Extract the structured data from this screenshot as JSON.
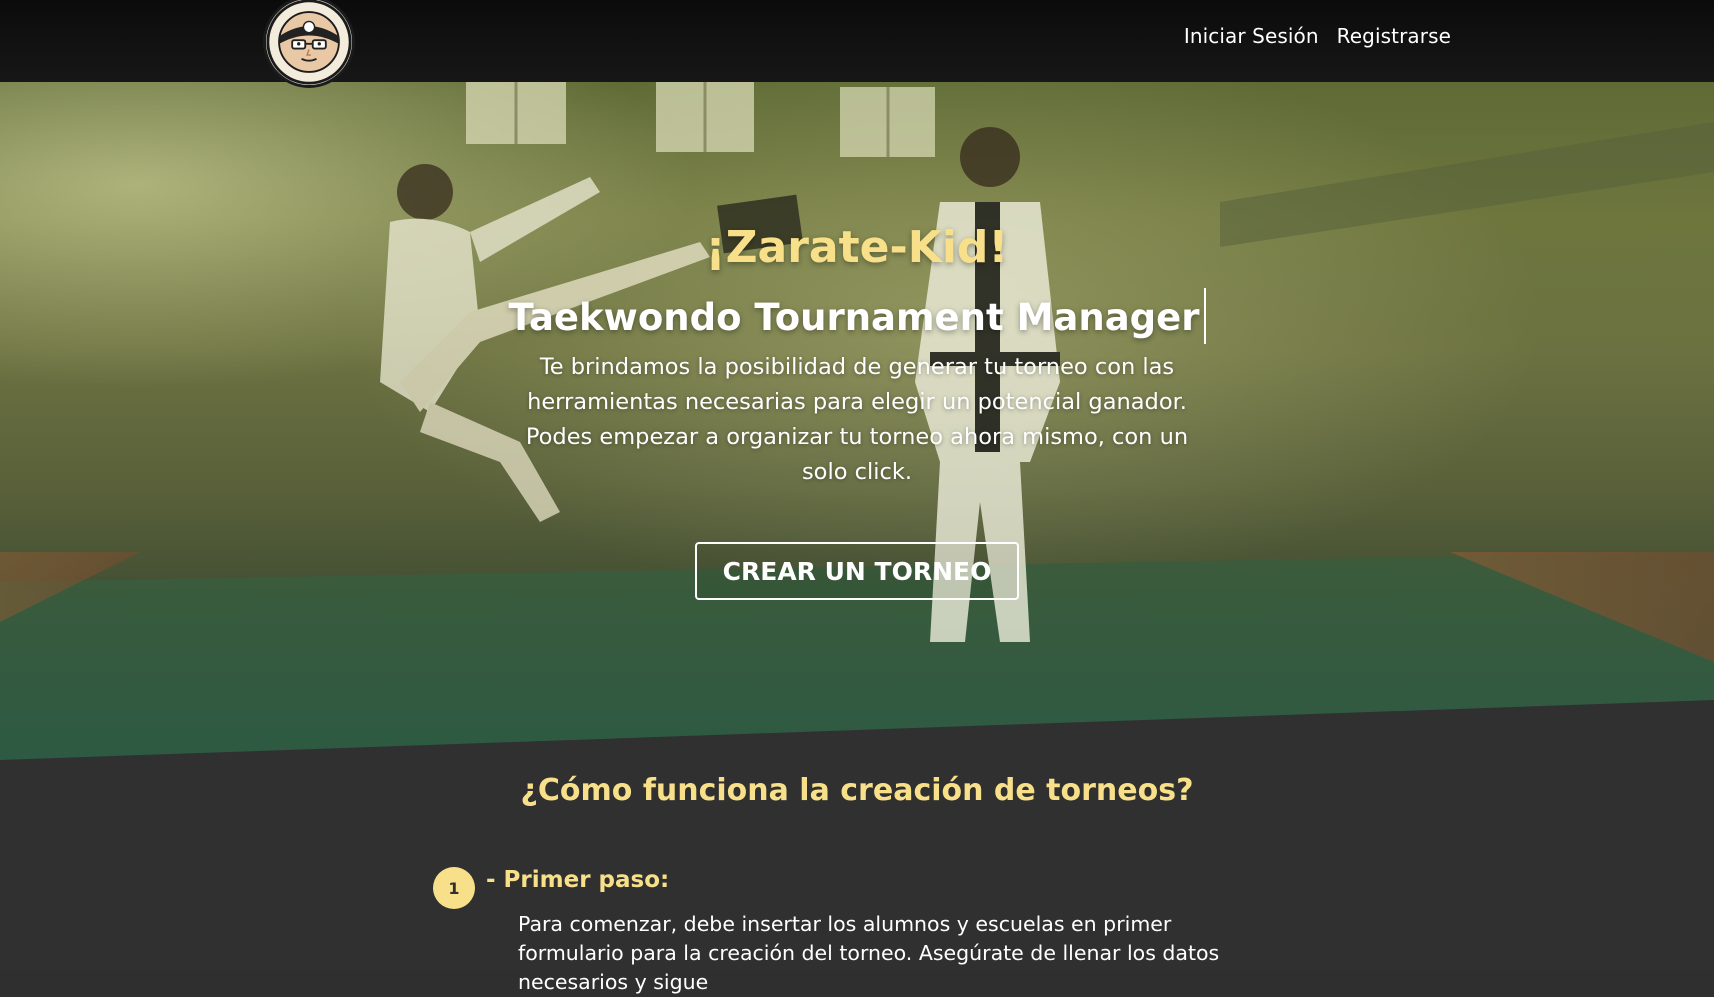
{
  "brand": {
    "logo_alt": "Zarate-Kid Tournament Manager logo"
  },
  "nav": {
    "login": "Iniciar Sesión",
    "register": "Registrarse"
  },
  "hero": {
    "title": "¡Zarate-Kid!",
    "subtitle": "Taekwondo Tournament Manager",
    "description": "Te brindamos la posibilidad de generar tu torneo con las herramientas necesarias para elegir un potencial ganador. Podes empezar a organizar tu torneo ahora mismo, con un solo click.",
    "cta_label": "CREAR UN TORNEO"
  },
  "how_it_works": {
    "title": "¿Cómo funciona la creación de torneos?",
    "steps": [
      {
        "number": "1",
        "title": "- Primer paso:",
        "text": "Para comenzar, debe insertar los alumnos y escuelas en primer formulario para la creación del torneo. Asegúrate de llenar los datos necesarios y sigue"
      }
    ]
  },
  "colors": {
    "accent": "#f8e08a",
    "navbar": "#111111",
    "section_bg": "#303031"
  }
}
